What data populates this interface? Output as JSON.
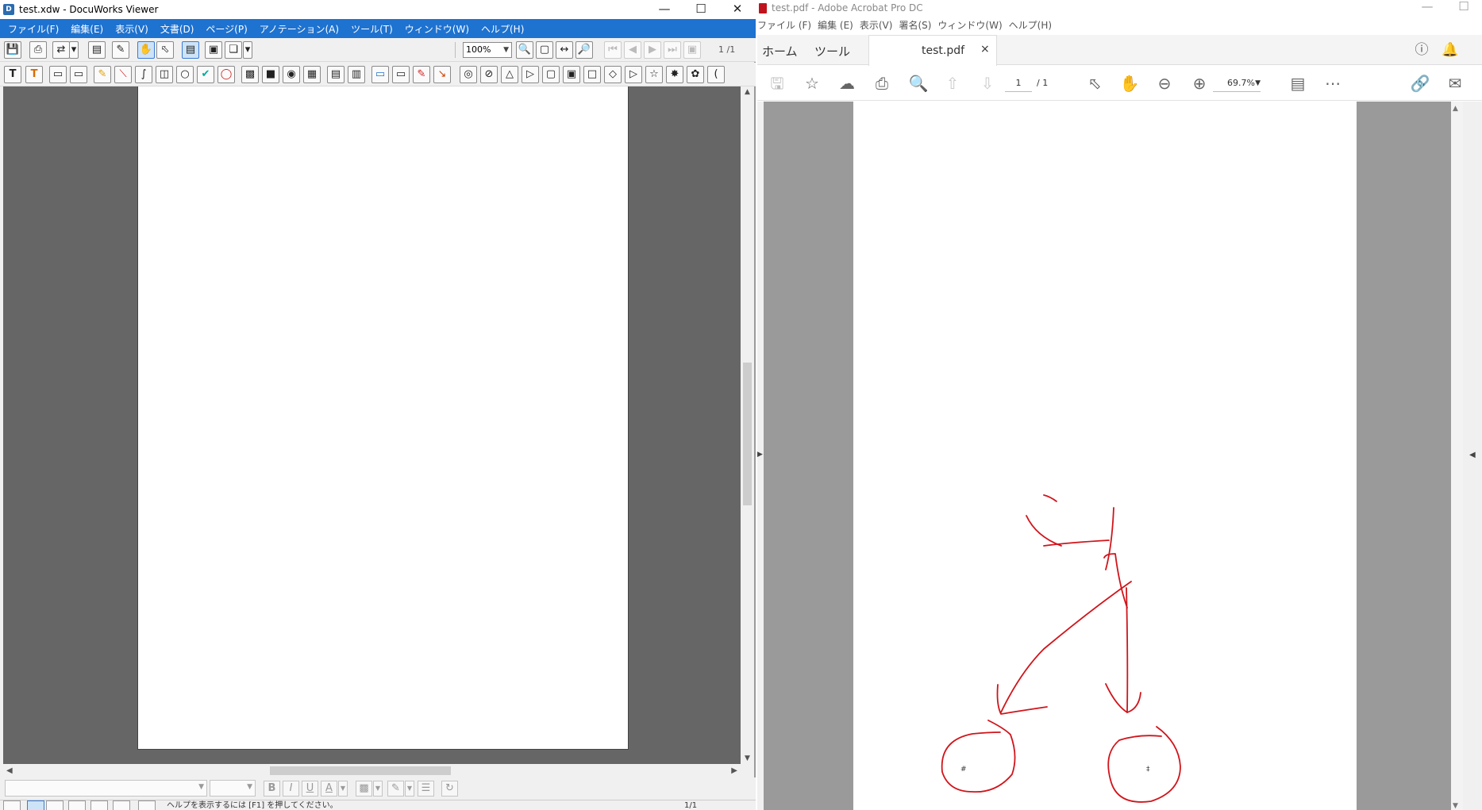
{
  "docuworks": {
    "title": "test.xdw - DocuWorks Viewer",
    "menu": [
      "ファイル(F)",
      "編集(E)",
      "表示(V)",
      "文書(D)",
      "ページ(P)",
      "アノテーション(A)",
      "ツール(T)",
      "ウィンドウ(W)",
      "ヘルプ(H)"
    ],
    "zoom": "100%",
    "page_indicator": "1 /1",
    "status_text": "ヘルプを表示するには [F1] を押してください。",
    "status_page": "1/1",
    "format_bold": "B",
    "format_italic": "I",
    "format_underline": "U",
    "format_font_color": "A",
    "text_tool": "T",
    "text_tool_alt": "T"
  },
  "acrobat": {
    "title": "test.pdf - Adobe Acrobat Pro DC",
    "menu": [
      "ファイル (F)",
      "編集 (E)",
      "表示(V)",
      "署名(S)",
      "ウィンドウ(W)",
      "ヘルプ(H)"
    ],
    "tab_home": "ホーム",
    "tab_tools": "ツール",
    "doc_tab": "test.pdf",
    "doc_tab_close": "×",
    "page_current": "1",
    "page_total": "/ 1",
    "zoom": "69.7%",
    "annotation_labels": [
      "#",
      "‡"
    ],
    "ink_color": "#d0151b"
  }
}
